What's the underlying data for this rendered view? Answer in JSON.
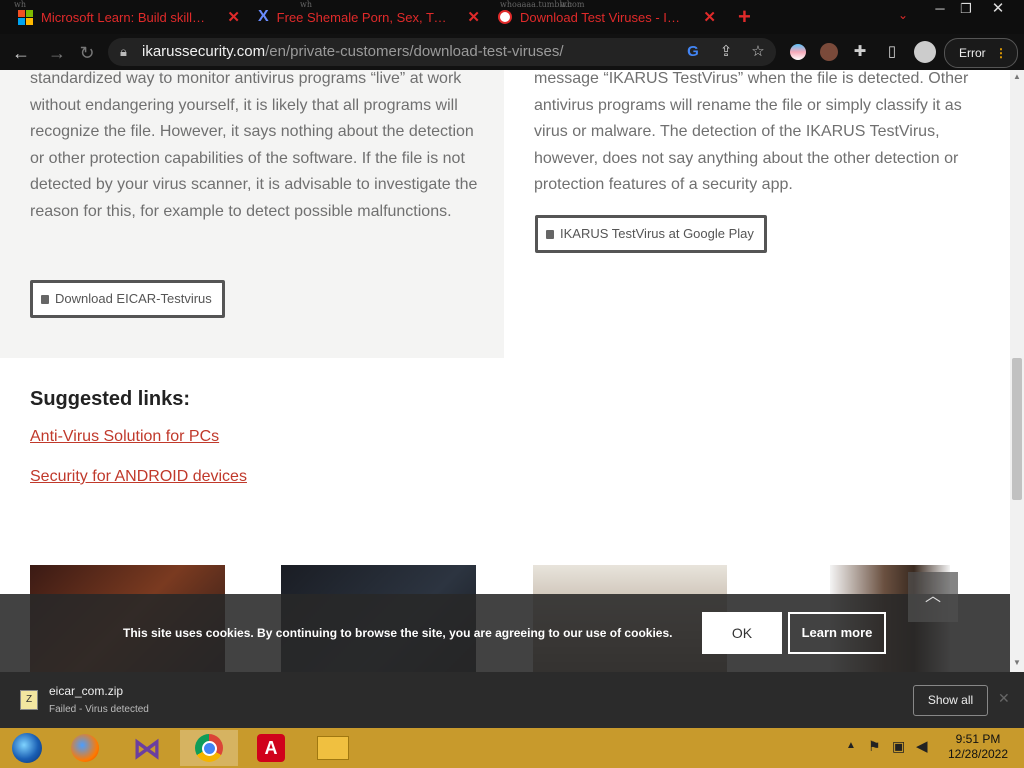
{
  "browser": {
    "tabs": [
      {
        "title": "Microsoft Learn: Build skills that",
        "icon": "windows-logo-icon"
      },
      {
        "title": "Free Shemale Porn, Sex, Tube Vi",
        "icon": "x-logo-icon"
      },
      {
        "title": "Download Test Viruses - IKARUS",
        "icon": "ikarus-logo-icon"
      }
    ],
    "new_tab_label": "+",
    "ghost_texts": [
      "wh",
      "wh",
      "wh",
      "whoaaaa.tumblr.com"
    ],
    "url_domain": "ikarussecurity.com",
    "url_path": "/en/private-customers/download-test-viruses/",
    "error_label": "Error"
  },
  "page": {
    "left_paragraph": "standardized way to monitor antivirus programs “live” at work without endangering yourself, it is likely that all programs will recognize the file. However, it says nothing about the detection or other protection capabilities of the software. If the file is not detected by your virus scanner, it is advisable to investigate the reason for this, for example to detect possible malfunctions.",
    "right_paragraph": "message “IKARUS TestVirus” when the file is detected. Other antivirus programs will rename the file or simply classify it as virus or malware. The detection of the IKARUS TestVirus, however, does not say anything about the other detection or protection features of a security app.",
    "download_eicar_label": "Download EICAR-Testvirus",
    "google_play_label": "IKARUS TestVirus at Google Play",
    "suggested_title": "Suggested links:",
    "links": [
      "Anti-Virus Solution for PCs",
      "Security for ANDROID devices"
    ],
    "cookie_text": "This site uses cookies. By continuing to browse the site, you are agreeing to our use of cookies.",
    "cookie_ok": "OK",
    "cookie_learn_more": "Learn more",
    "scroll_top_icon": "chevron-up-icon"
  },
  "downloads": {
    "file_name": "eicar_com.zip",
    "status": "Failed - Virus detected",
    "show_all": "Show all"
  },
  "taskbar": {
    "time": "9:51 PM",
    "date": "12/28/2022",
    "apps": [
      "media-center-icon",
      "firefox-icon",
      "visual-studio-icon",
      "chrome-icon",
      "avira-icon",
      "file-explorer-icon"
    ]
  },
  "colors": {
    "tab_text": "#e02a2a",
    "link": "#c0392b",
    "taskbar": "#c89a2c"
  }
}
